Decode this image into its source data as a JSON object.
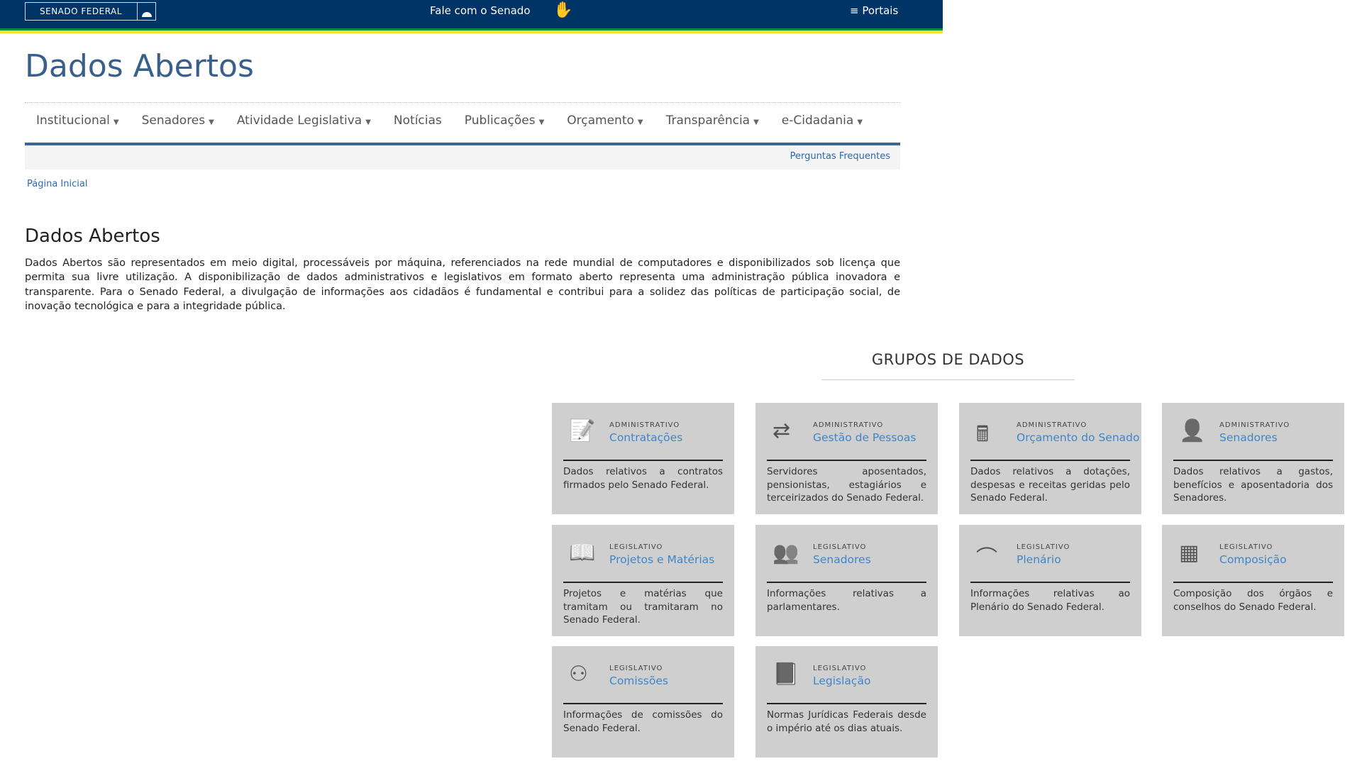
{
  "header": {
    "logo": "SENADO FEDERAL",
    "contact": "Fale com o Senado",
    "portals": "Portais",
    "portals_icon": "hamburger-icon",
    "sign_icon": "sign-language-hands-icon"
  },
  "page_title": "Dados Abertos",
  "nav": [
    {
      "label": "Institucional",
      "dropdown": true
    },
    {
      "label": "Senadores",
      "dropdown": true
    },
    {
      "label": "Atividade Legislativa",
      "dropdown": true
    },
    {
      "label": "Notícias",
      "dropdown": false
    },
    {
      "label": "Publicações",
      "dropdown": true
    },
    {
      "label": "Orçamento",
      "dropdown": true
    },
    {
      "label": "Transparência",
      "dropdown": true
    },
    {
      "label": "e-Cidadania",
      "dropdown": true
    }
  ],
  "faq": "Perguntas Frequentes",
  "breadcrumb": "Página Inicial",
  "section_title": "Dados Abertos",
  "intro": "Dados Abertos são representados em meio digital, processáveis por máquina, referenciados na rede mundial de computadores e disponibilizados sob licença que permita sua livre utilização. A disponibilização de dados administrativos e legislativos em formato aberto representa uma administração pública inovadora e transparente. Para o Senado Federal, a divulgação de informações aos cidadãos é fundamental e contribui para a solidez das políticas de participação social, de inovação tecnológica e para a integridade pública.",
  "groups_title": "GRUPOS DE DADOS",
  "cards": [
    {
      "category": "ADMINISTRATIVO",
      "name": "Contratações",
      "desc": "Dados relativos a contratos firmados pelo Senado Federal.",
      "icon": "contract-icon"
    },
    {
      "category": "ADMINISTRATIVO",
      "name": "Gestão de Pessoas",
      "desc": "Servidores aposentados, pensionistas, estagiários e terceirizados do Senado Federal.",
      "icon": "people-exchange-icon"
    },
    {
      "category": "ADMINISTRATIVO",
      "name": "Orçamento do Senado",
      "desc": "Dados relativos a dotações, despesas e receitas geridas pelo Senado Federal.",
      "icon": "calculator-icon"
    },
    {
      "category": "ADMINISTRATIVO",
      "name": "Senadores",
      "desc": "Dados relativos a gastos, benefícios e aposentadoria dos Senadores.",
      "icon": "person-icon"
    },
    {
      "category": "LEGISLATIVO",
      "name": "Projetos e Matérias",
      "desc": "Projetos e matérias que tramitam ou tramitaram no Senado Federal.",
      "icon": "book-icon"
    },
    {
      "category": "LEGISLATIVO",
      "name": "Senadores",
      "desc": "Informações relativas a parlamentares.",
      "icon": "group-icon"
    },
    {
      "category": "LEGISLATIVO",
      "name": "Plenário",
      "desc": "Informações relativas ao Plenário do Senado Federal.",
      "icon": "plenary-icon"
    },
    {
      "category": "LEGISLATIVO",
      "name": "Composição",
      "desc": "Composição dos órgãos e conselhos do Senado Federal.",
      "icon": "grid-icon"
    },
    {
      "category": "LEGISLATIVO",
      "name": "Comissões",
      "desc": "Informações de comissões do Senado Federal.",
      "icon": "hierarchy-icon"
    },
    {
      "category": "LEGISLATIVO",
      "name": "Legislação",
      "desc": "Normas Jurídicas Federais desde o império até os dias atuais.",
      "icon": "law-book-icon"
    }
  ]
}
